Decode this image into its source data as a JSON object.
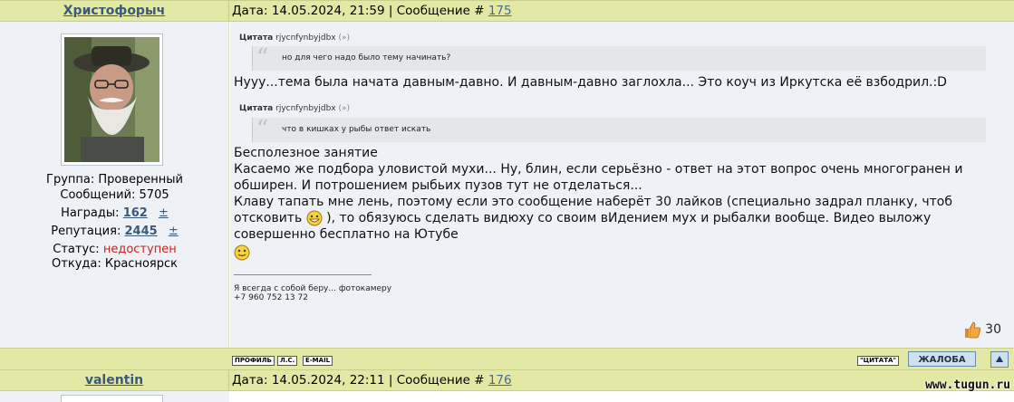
{
  "post1": {
    "author": "Христофорыч",
    "date_label": "Дата:",
    "date": "14.05.2024, 21:59",
    "msg_label": "| Сообщение #",
    "msg_num": "175",
    "profile": {
      "group": "Группа: Проверенный",
      "messages": "Сообщений: 5705",
      "awards_label": "Награды:",
      "awards": "162",
      "rep_label": "Репутация:",
      "rep": "2445",
      "plus": "±",
      "status_label": "Статус:",
      "status": "недоступен",
      "from": "Откуда: Красноярск"
    },
    "quote1": {
      "label": "Цитата",
      "author": "rjycnfynbyjdbx",
      "arrow": "(»)",
      "text": "но для чего надо было тему начинать?"
    },
    "text1": "Нууу...тема была начата давным-давно.  И давным-давно заглохла... Это коуч из Иркутска её взбодрил.:D",
    "quote2": {
      "label": "Цитата",
      "author": "rjycnfynbyjdbx",
      "arrow": "(»)",
      "text": "что в кишках у рыбы ответ искать"
    },
    "body_lines": [
      "Бесполезное занятие",
      "Касаемо же подбора уловистой мухи... Ну, блин, если серьёзно - ответ на этот вопрос очень многогранен и",
      "обширен. И потрошением рыбьих пузов тут не отделаться...",
      "Клаву тапать мне лень, поэтому если это сообщение наберёт 30 лайков (специально задрал планку, чтоб",
      "отсковить",
      "), то обязуюсь сделать видюху со своим вИдением мух и рыбалки вообще. Видео выложу",
      "совершенно бесплатно на Ютубе"
    ],
    "signature": [
      "Я всегда с собой беру... фотокамеру",
      "+7 960 752 13 72"
    ],
    "likes": "30"
  },
  "buttons": {
    "profile": "ПРОФИЛЬ",
    "pm": "Л.С.",
    "email": "E-MAIL",
    "quote": "\"ЦИТАТА\"",
    "complaint": "ЖАЛОБА"
  },
  "post2": {
    "author": "valentin",
    "date_label": "Дата:",
    "date": "14.05.2024, 22:11",
    "msg_label": "| Сообщение #",
    "msg_num": "176"
  },
  "watermark": "www.tugun.ru",
  "icons": [
    "thumbs-up-icon",
    "grin-smiley-icon",
    "smile-smiley-icon",
    "arrow-up-icon",
    "quote-mark-icon"
  ],
  "colors": {
    "header_bg": "#e3e9a5",
    "panel_bg": "#eef2f6",
    "link": "#3a5a7a",
    "offline": "#cc2222"
  }
}
